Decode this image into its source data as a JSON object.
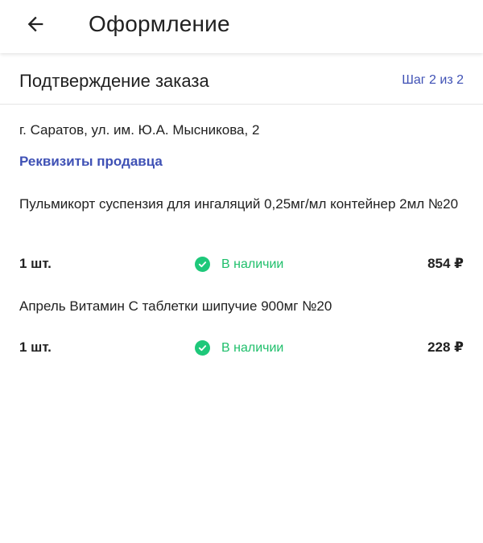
{
  "appbar": {
    "title": "Оформление",
    "back_icon": "arrow-left-icon"
  },
  "section": {
    "title": "Подтверждение заказа",
    "step": "Шаг 2 из 2"
  },
  "address": "г. Саратов, ул. им. Ю.А. Мысникова, 2",
  "seller_link": "Реквизиты продавца",
  "colors": {
    "accent": "#3f51b5",
    "in_stock": "#1ec87a",
    "text": "#212121"
  },
  "products": [
    {
      "name": "Пульмикорт суспензия для ингаляций 0,25мг/мл контейнер 2мл №20",
      "quantity": "1 шт.",
      "availability": "В наличии",
      "price": "854 ₽"
    },
    {
      "name": "Апрель Витамин С таблетки шипучие 900мг №20",
      "quantity": "1 шт.",
      "availability": "В наличии",
      "price": "228 ₽"
    }
  ]
}
